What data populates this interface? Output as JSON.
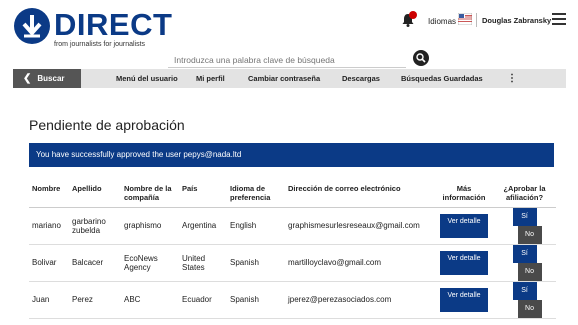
{
  "header": {
    "logo_text": "DIRECT",
    "tagline": "from journalists for journalists",
    "search_placeholder": "Introduzca una palabra clave de búsqueda",
    "idiomas_label": "Idiomas",
    "user_name": "Douglas Zabransky"
  },
  "nav": {
    "back_label": "Buscar",
    "items": [
      "Menú del usuario",
      "Mi perfil",
      "Cambiar contraseña",
      "Descargas",
      "Búsquedas Guardadas"
    ]
  },
  "main": {
    "title": "Pendiente de aprobación",
    "alert": "You have successfully approved the user pepys@nada.ltd"
  },
  "table": {
    "headers": {
      "nombre": "Nombre",
      "apellido": "Apellido",
      "compania": "Nombre de la compañía",
      "pais": "País",
      "idioma": "Idioma de preferencia",
      "email": "Dirección de correo electrónico",
      "info": "Más información",
      "aprobar": "¿Aprobar la afiliación?"
    },
    "ver_label": "Ver detalle",
    "si_label": "Sí",
    "no_label": "No",
    "rows": [
      {
        "nombre": "mariano",
        "apellido": "garbarino zubelda",
        "compania": "graphismo",
        "pais": "Argentina",
        "idioma": "English",
        "email": "graphismesurlesreseaux@gmail.com"
      },
      {
        "nombre": "Bolivar",
        "apellido": "Balcacer",
        "compania": "EcoNews Agency",
        "pais": "United States",
        "idioma": "Spanish",
        "email": "martilloyclavo@gmail.com"
      },
      {
        "nombre": "Juan",
        "apellido": "Perez",
        "compania": "ABC",
        "pais": "Ecuador",
        "idioma": "Spanish",
        "email": "jperez@perezasociados.com"
      }
    ]
  },
  "colors": {
    "brand_blue": "#0b3a86",
    "nav_dark": "#555555",
    "no_button": "#4a4a4a"
  }
}
